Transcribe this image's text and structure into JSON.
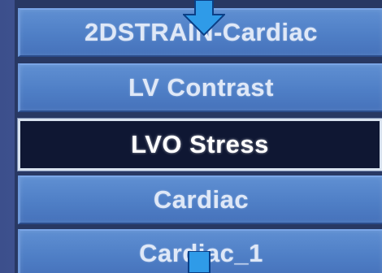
{
  "menu": {
    "items": [
      {
        "label": "2DSTRAIN-Cardiac",
        "selected": false
      },
      {
        "label": "LV Contrast",
        "selected": false
      },
      {
        "label": "LVO Stress",
        "selected": true
      },
      {
        "label": "Cardiac",
        "selected": false
      },
      {
        "label": "Cardiac_1",
        "selected": false
      }
    ]
  },
  "icons": {
    "scroll_up": "down-arrow-indicator-icon",
    "scroll_down": "down-arrow-indicator-icon"
  },
  "colors": {
    "item_fill": "#5a8bd0",
    "item_text": "#dfe8f7",
    "selected_fill": "#0f1733",
    "selected_border": "#d8e2ef",
    "background": "#3f5391",
    "arrow": "#2f9be8"
  }
}
